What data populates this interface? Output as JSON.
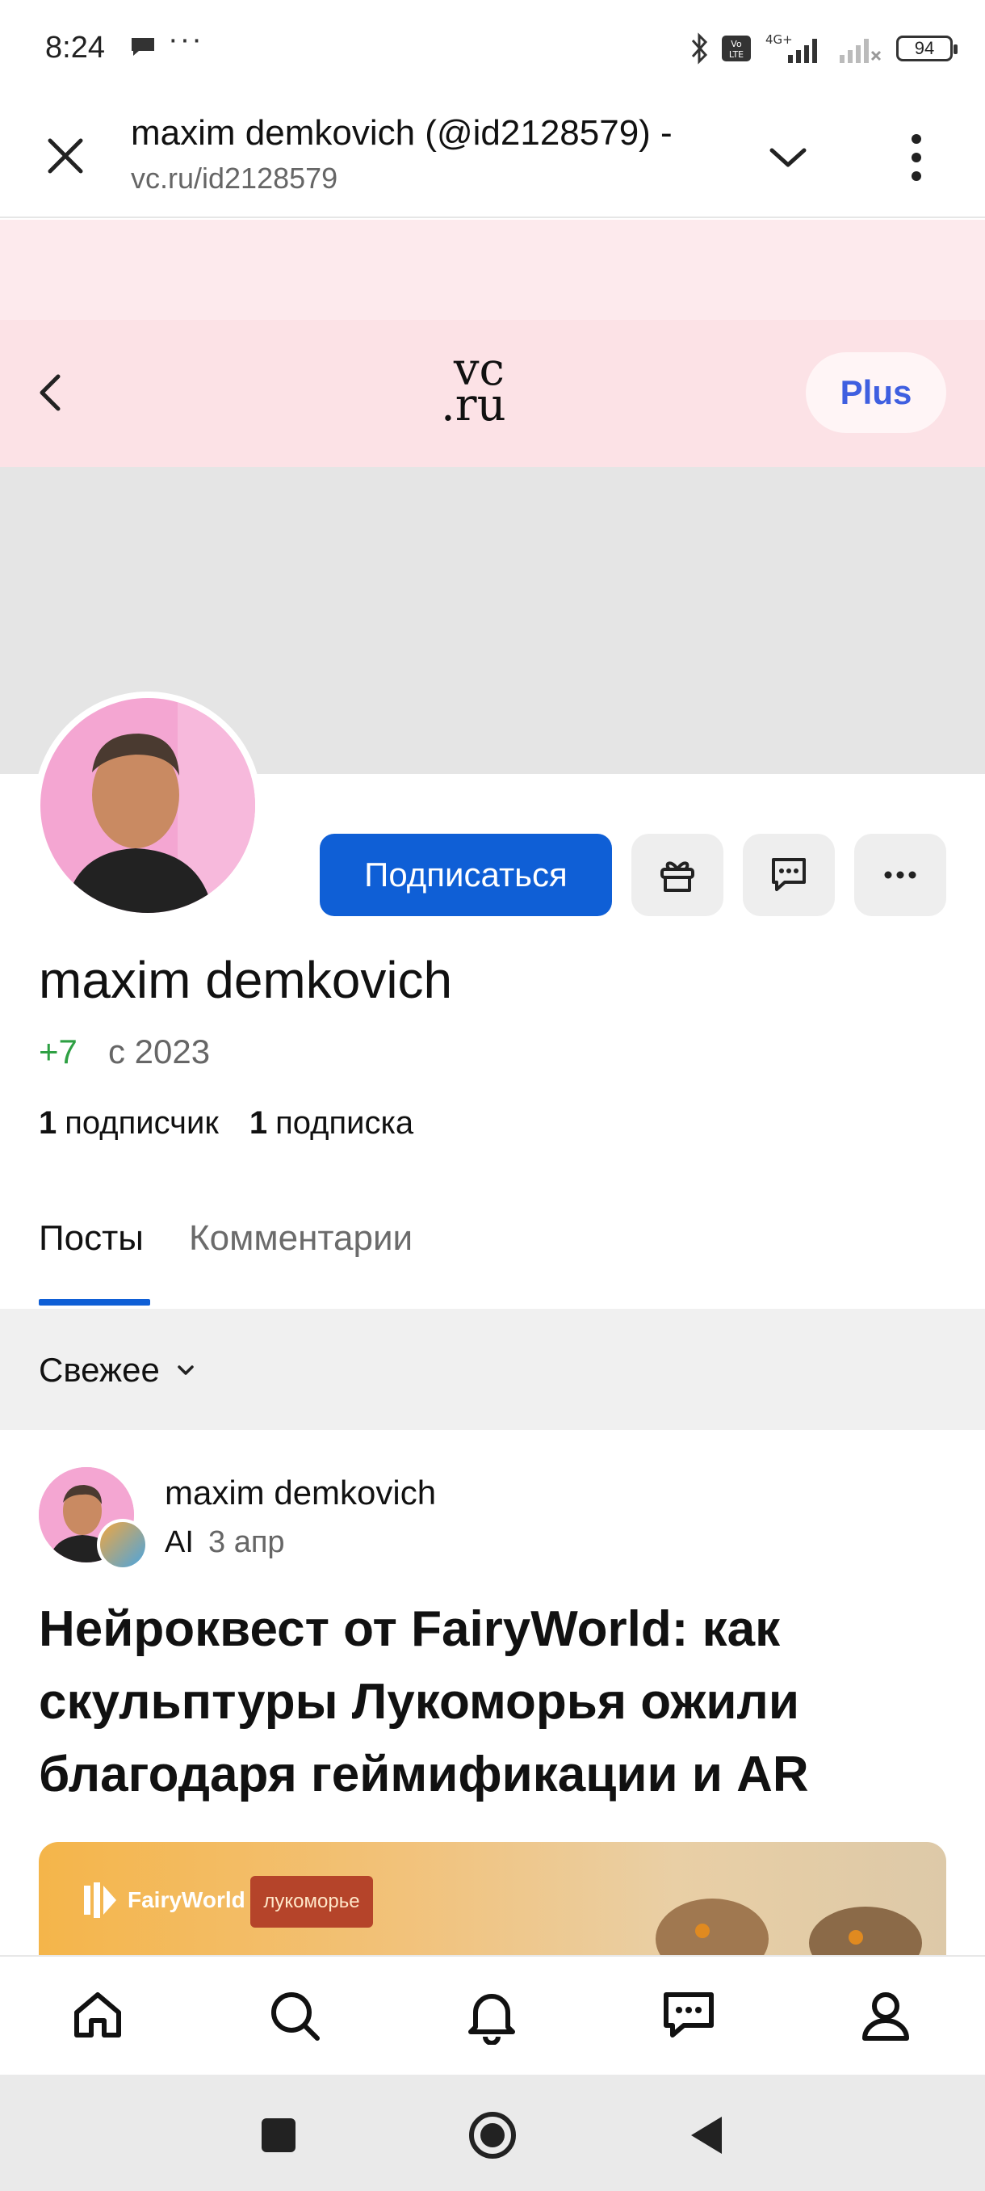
{
  "status_bar": {
    "time": "8:24",
    "dots": "···",
    "battery": "94"
  },
  "browser": {
    "title": "maxim demkovich (@id2128579) -",
    "url": "vc.ru/id2128579"
  },
  "header": {
    "logo_line1": "vc",
    "logo_line2": ".ru",
    "plus_label": "Plus"
  },
  "profile": {
    "name": "maxim demkovich",
    "rating": "+7",
    "since": "с 2023",
    "followers_count": "1",
    "followers_label": "подписчик",
    "following_count": "1",
    "following_label": "подписка",
    "subscribe_label": "Подписаться"
  },
  "tabs": [
    {
      "label": "Посты",
      "active": true
    },
    {
      "label": "Комментарии",
      "active": false
    }
  ],
  "filter": {
    "label": "Свежее"
  },
  "post": {
    "author": "maxim demkovich",
    "subsite": "AI",
    "date": "3 апр",
    "title": "Нейроквест от FairyWorld: как скульптуры Лукоморья ожили благодаря геймификации и AR",
    "image_brand": "FairyWorld",
    "image_badge": "лукоморье"
  },
  "colors": {
    "accent": "#0f5fd6",
    "rating_green": "#2ea043",
    "header_pink": "#fce2e6",
    "plus_blue": "#3f5fe0"
  },
  "icons": {
    "nav": [
      "home-icon",
      "search-icon",
      "bell-icon",
      "chat-icon",
      "profile-icon"
    ]
  }
}
